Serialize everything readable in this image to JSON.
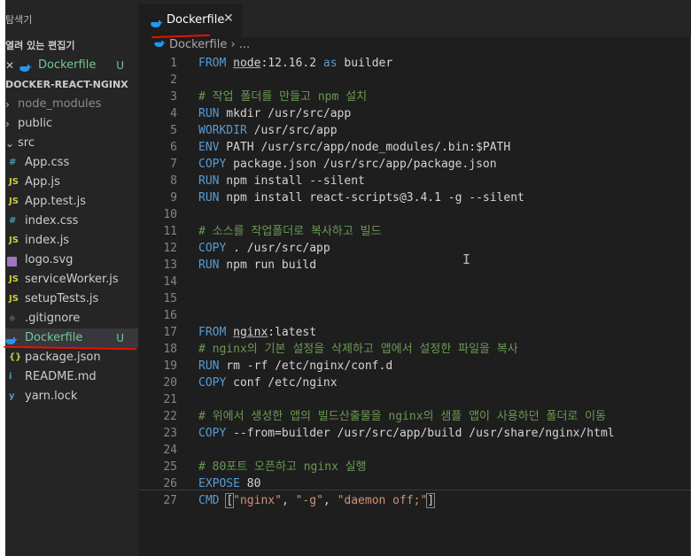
{
  "explorer": {
    "header": "탐색기",
    "open_editors_title": "열려 있는 편집기",
    "open_editor": {
      "close": "✕",
      "name": "Dockerfile",
      "badge": "U"
    },
    "project_title": "DOCKER-REACT-NGINX",
    "tree": [
      {
        "chev": "›",
        "icon": "",
        "label": "node_modules",
        "badge": "",
        "dim": true
      },
      {
        "chev": "›",
        "icon": "",
        "label": "public",
        "badge": ""
      },
      {
        "chev": "⌄",
        "icon": "",
        "label": "src",
        "badge": ""
      },
      {
        "chev": "",
        "icon": "#",
        "label": "App.css",
        "badge": ""
      },
      {
        "chev": "",
        "icon": "JS",
        "label": "App.js",
        "badge": ""
      },
      {
        "chev": "",
        "icon": "JS",
        "label": "App.test.js",
        "badge": ""
      },
      {
        "chev": "",
        "icon": "#",
        "label": "index.css",
        "badge": ""
      },
      {
        "chev": "",
        "icon": "JS",
        "label": "index.js",
        "badge": ""
      },
      {
        "chev": "",
        "icon": "svg",
        "label": "logo.svg",
        "badge": ""
      },
      {
        "chev": "",
        "icon": "JS",
        "label": "serviceWorker.js",
        "badge": ""
      },
      {
        "chev": "",
        "icon": "JS",
        "label": "setupTests.js",
        "badge": ""
      },
      {
        "chev": "",
        "icon": "◆",
        "label": ".gitignore",
        "badge": ""
      },
      {
        "chev": "",
        "icon": "whale",
        "label": "Dockerfile",
        "badge": "U"
      },
      {
        "chev": "",
        "icon": "{}",
        "label": "package.json",
        "badge": ""
      },
      {
        "chev": "",
        "icon": "i",
        "label": "README.md",
        "badge": ""
      },
      {
        "chev": "",
        "icon": "y",
        "label": "yarn.lock",
        "badge": ""
      }
    ]
  },
  "editor": {
    "tab": {
      "name": "Dockerfile",
      "close": "✕"
    },
    "breadcrumb": {
      "file": "Dockerfile",
      "sep": " › ",
      "more": "..."
    },
    "lines": [
      {
        "n": "1",
        "tokens": [
          {
            "t": "FROM",
            "c": "kw"
          },
          {
            "t": " "
          },
          {
            "t": "node",
            "c": "ul"
          },
          {
            "t": ":12.16.2 "
          },
          {
            "t": "as",
            "c": "kw"
          },
          {
            "t": " builder"
          }
        ]
      },
      {
        "n": "2",
        "tokens": []
      },
      {
        "n": "3",
        "tokens": [
          {
            "t": "# 작업 폴더를 만들고 npm 설치",
            "c": "cm"
          }
        ]
      },
      {
        "n": "4",
        "tokens": [
          {
            "t": "RUN",
            "c": "kw"
          },
          {
            "t": " mkdir /usr/src/app"
          }
        ]
      },
      {
        "n": "5",
        "tokens": [
          {
            "t": "WORKDIR",
            "c": "kw"
          },
          {
            "t": " /usr/src/app"
          }
        ]
      },
      {
        "n": "6",
        "tokens": [
          {
            "t": "ENV",
            "c": "kw"
          },
          {
            "t": " PATH /usr/src/app/node_modules/.bin:$PATH"
          }
        ]
      },
      {
        "n": "7",
        "tokens": [
          {
            "t": "COPY",
            "c": "kw"
          },
          {
            "t": " package.json /usr/src/app/package.json"
          }
        ]
      },
      {
        "n": "8",
        "tokens": [
          {
            "t": "RUN",
            "c": "kw"
          },
          {
            "t": " npm install --silent"
          }
        ]
      },
      {
        "n": "9",
        "tokens": [
          {
            "t": "RUN",
            "c": "kw"
          },
          {
            "t": " npm install react-scripts@3.4.1 -g --silent"
          }
        ]
      },
      {
        "n": "10",
        "tokens": []
      },
      {
        "n": "11",
        "tokens": [
          {
            "t": "# 소스를 작업폴더로 복사하고 빌드",
            "c": "cm"
          }
        ]
      },
      {
        "n": "12",
        "tokens": [
          {
            "t": "COPY",
            "c": "kw"
          },
          {
            "t": " . /usr/src/app"
          }
        ]
      },
      {
        "n": "13",
        "tokens": [
          {
            "t": "RUN",
            "c": "kw"
          },
          {
            "t": " npm run build"
          }
        ]
      },
      {
        "n": "14",
        "tokens": []
      },
      {
        "n": "15",
        "tokens": []
      },
      {
        "n": "16",
        "tokens": []
      },
      {
        "n": "17",
        "tokens": [
          {
            "t": "FROM",
            "c": "kw"
          },
          {
            "t": " "
          },
          {
            "t": "nginx",
            "c": "ul"
          },
          {
            "t": ":latest"
          }
        ]
      },
      {
        "n": "18",
        "tokens": [
          {
            "t": "# nginx의 기본 설정을 삭제하고 앱에서 설정한 파일을 복사",
            "c": "cm"
          }
        ]
      },
      {
        "n": "19",
        "tokens": [
          {
            "t": "RUN",
            "c": "kw"
          },
          {
            "t": " rm -rf /etc/nginx/conf.d"
          }
        ]
      },
      {
        "n": "20",
        "tokens": [
          {
            "t": "COPY",
            "c": "kw"
          },
          {
            "t": " conf /etc/nginx"
          }
        ]
      },
      {
        "n": "21",
        "tokens": []
      },
      {
        "n": "22",
        "tokens": [
          {
            "t": "# 위에서 생성한 앱의 빌드산출물을 nginx의 샘플 앱이 사용하던 폴더로 이동",
            "c": "cm"
          }
        ]
      },
      {
        "n": "23",
        "tokens": [
          {
            "t": "COPY",
            "c": "kw"
          },
          {
            "t": " --from=builder /usr/src/app/build /usr/share/nginx/html"
          }
        ]
      },
      {
        "n": "24",
        "tokens": []
      },
      {
        "n": "25",
        "tokens": [
          {
            "t": "# 80포트 오픈하고 nginx 실행",
            "c": "cm"
          }
        ]
      },
      {
        "n": "26",
        "tokens": [
          {
            "t": "EXPOSE",
            "c": "kw"
          },
          {
            "t": " 80"
          }
        ]
      },
      {
        "n": "27",
        "tokens": [
          {
            "t": "CMD",
            "c": "kw"
          },
          {
            "t": " "
          },
          {
            "t": "[",
            "c": "br"
          },
          {
            "t": "\"nginx\"",
            "c": "str"
          },
          {
            "t": ", "
          },
          {
            "t": "\"-g\"",
            "c": "str"
          },
          {
            "t": ", "
          },
          {
            "t": "\"daemon off;\"",
            "c": "str"
          },
          {
            "t": "]",
            "c": "br"
          }
        ]
      }
    ]
  },
  "colors": {
    "keyword": "#569cd6",
    "comment": "#6a9955",
    "string": "#ce9178",
    "untracked": "#73c991",
    "docker": "#2496ed",
    "annotation_red": "#e51400"
  }
}
